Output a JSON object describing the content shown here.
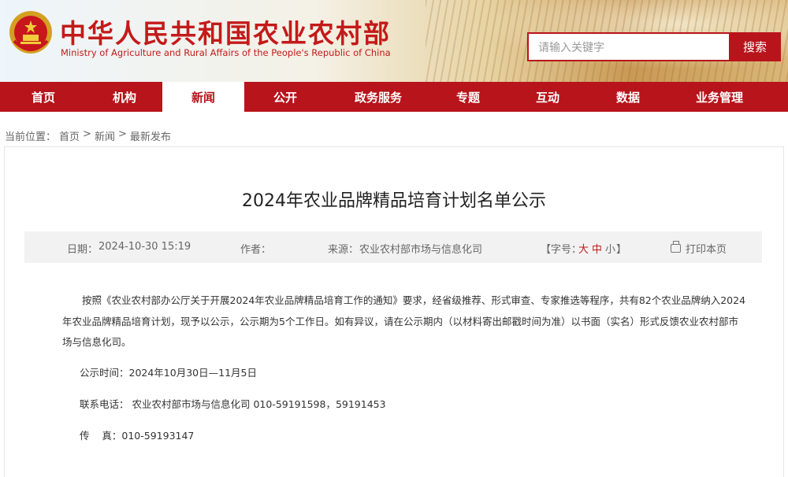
{
  "header": {
    "title": "中华人民共和国农业农村部",
    "subtitle": "Ministry of Agriculture and Rural Affairs of the People's Republic of China",
    "search_placeholder": "请输入关键字",
    "search_button": "搜索",
    "emblem_icon": "national-emblem-icon"
  },
  "nav": {
    "items": [
      {
        "label": "首页"
      },
      {
        "label": "机构"
      },
      {
        "label": "新闻"
      },
      {
        "label": "公开"
      },
      {
        "label": "政务服务"
      },
      {
        "label": "专题"
      },
      {
        "label": "互动"
      },
      {
        "label": "数据"
      },
      {
        "label": "业务管理"
      }
    ],
    "active_index": 2
  },
  "breadcrumb": {
    "prefix": "当前位置：",
    "items": [
      "首页",
      "新闻",
      "最新发布"
    ],
    "separator": ">"
  },
  "article": {
    "title": "2024年农业品牌精品培育计划名单公示",
    "meta": {
      "date_label": "日期：",
      "date_value": "2024-10-30 15:19",
      "author_label": "作者：",
      "source_label": "来源：",
      "source_value": "农业农村部市场与信息化司",
      "font_label": "【字号：",
      "font_large": "大",
      "font_medium": "中",
      "font_small": "小",
      "font_close": "】",
      "print_label": "打印本页"
    },
    "paragraph": "按照《农业农村部办公厅关于开展2024年农业品牌精品培育工作的通知》要求，经省级推荐、形式审查、专家推选等程序，共有82个农业品牌纳入2024年农业品牌精品培育计划，现予以公示，公示期为5个工作日。如有异议，请在公示期内（以材料寄出邮戳时间为准）以书面（实名）形式反馈农业农村部市场与信息化司。",
    "period": "公示时间：2024年10月30日—11月5日",
    "phone": "联系电话： 农业农村部市场与信息化司 010-59191598，59191453",
    "fax": "传    真：010-59193147"
  },
  "colors": {
    "brand_red": "#b8141b",
    "title_red": "#c41a1a"
  }
}
